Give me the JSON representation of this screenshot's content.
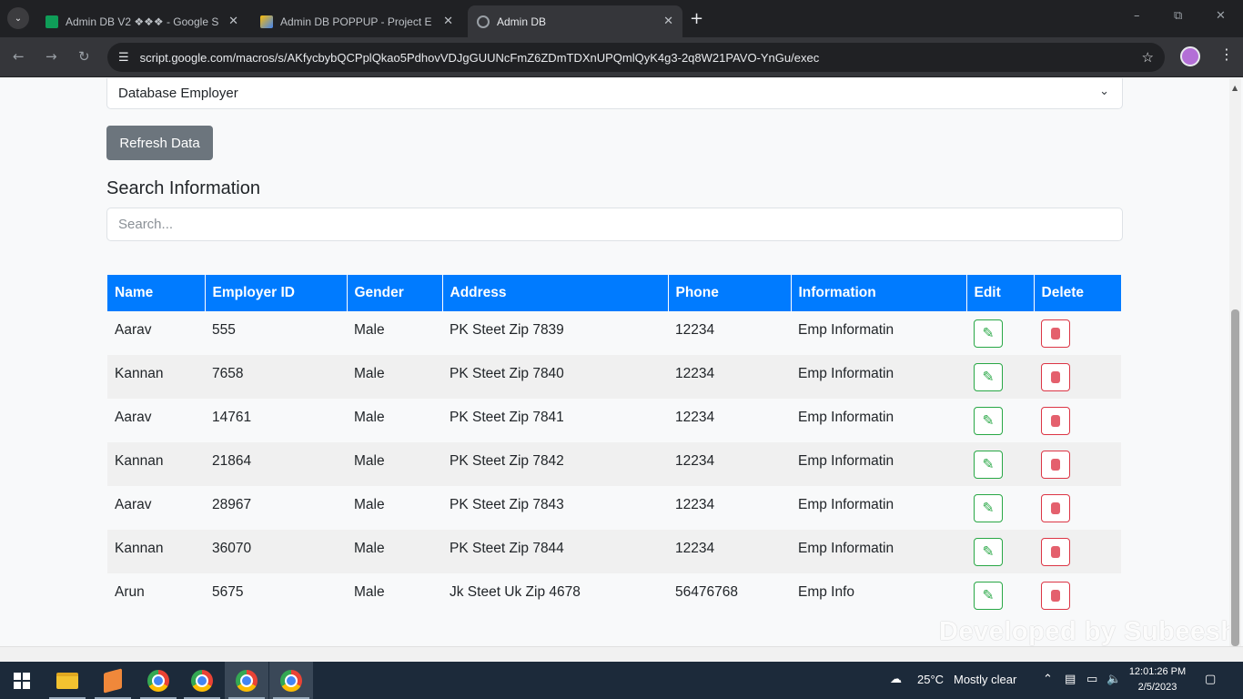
{
  "browser": {
    "tabs": [
      {
        "title": "Admin DB V2 ❖❖❖ - Google S",
        "active": false
      },
      {
        "title": "Admin DB POPPUP - Project E",
        "active": false
      },
      {
        "title": "Admin DB",
        "active": true
      }
    ],
    "url": "script.google.com/macros/s/AKfycbybQCPplQkao5PdhovVDJgGUUNcFmZ6ZDmTDXnUPQmlQyK4g3-2q8W21PAVO-YnGu/exec",
    "new_tab_symbol": "+",
    "window_controls": [
      "–",
      "⧉",
      "✕"
    ]
  },
  "page": {
    "dropdown": {
      "selected": "Database Employer"
    },
    "refresh_label": "Refresh Data",
    "search_heading": "Search Information",
    "search": {
      "placeholder": "Search...",
      "value": ""
    },
    "table": {
      "headers": [
        "Name",
        "Employer ID",
        "Gender",
        "Address",
        "Phone",
        "Information",
        "Edit",
        "Delete"
      ],
      "rows": [
        [
          "Aarav",
          "555",
          "Male",
          "PK Steet Zip 7839",
          "12234",
          "Emp Informatin"
        ],
        [
          "Kannan",
          "7658",
          "Male",
          "PK Steet Zip 7840",
          "12234",
          "Emp Informatin"
        ],
        [
          "Aarav",
          "14761",
          "Male",
          "PK Steet Zip 7841",
          "12234",
          "Emp Informatin"
        ],
        [
          "Kannan",
          "21864",
          "Male",
          "PK Steet Zip 7842",
          "12234",
          "Emp Informatin"
        ],
        [
          "Aarav",
          "28967",
          "Male",
          "PK Steet Zip 7843",
          "12234",
          "Emp Informatin"
        ],
        [
          "Kannan",
          "36070",
          "Male",
          "PK Steet Zip 7844",
          "12234",
          "Emp Informatin"
        ],
        [
          "Arun",
          "5675",
          "Male",
          "Jk Steet Uk Zip 4678",
          "56476768",
          "Emp Info"
        ]
      ]
    },
    "watermark": "Developed by Subeesh"
  },
  "taskbar": {
    "apps": [
      "start-icon",
      "file-explorer-icon",
      "sublime-text-icon",
      "chrome-icon",
      "chrome-icon",
      "chrome-icon",
      "chrome-icon"
    ],
    "weather": {
      "temp": "25°C",
      "condition": "Mostly clear"
    },
    "clock": {
      "time": "12:01:26 PM",
      "date": "2/5/2023"
    }
  },
  "colors": {
    "table_header": "#007bff",
    "refresh_button": "#6c757d",
    "edit_border": "#28a745",
    "delete_border": "#dc3545",
    "taskbar": "#1c2a3a"
  }
}
